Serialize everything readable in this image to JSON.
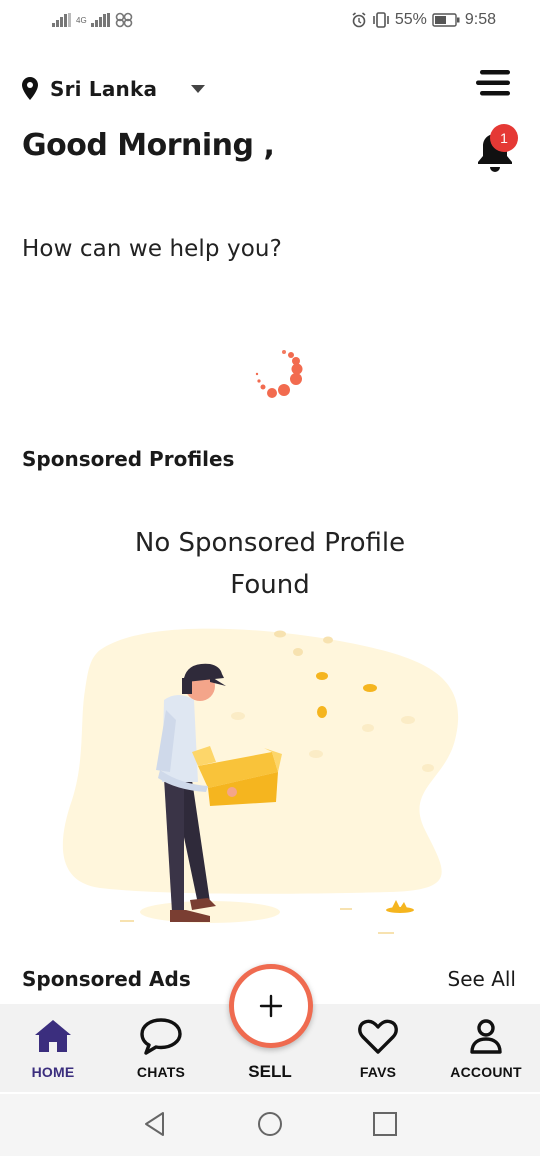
{
  "status_bar": {
    "network_label": "4G",
    "battery_percent": "55%",
    "time": "9:58"
  },
  "header": {
    "location": "Sri Lanka",
    "greeting": "Good Morning ,",
    "notification_count": "1"
  },
  "help_prompt": "How can we help you?",
  "sponsored_profiles": {
    "title": "Sponsored Profiles",
    "empty_line1": "No Sponsored Profile",
    "empty_line2": "Found"
  },
  "sponsored_ads": {
    "title": "Sponsored Ads",
    "see_all": "See All"
  },
  "bottom_nav": {
    "items": [
      {
        "label": "HOME",
        "icon": "home-icon",
        "active": true
      },
      {
        "label": "CHATS",
        "icon": "chat-icon",
        "active": false
      },
      {
        "label": "SELL",
        "icon": "plus-icon",
        "active": false
      },
      {
        "label": "FAVS",
        "icon": "heart-icon",
        "active": false
      },
      {
        "label": "ACCOUNT",
        "icon": "user-icon",
        "active": false
      }
    ]
  },
  "colors": {
    "accent": "#ef6b50",
    "active_nav": "#3b2e7e",
    "badge": "#e53935",
    "illustration_blob": "#fff6dc",
    "box": "#f5b51f"
  }
}
